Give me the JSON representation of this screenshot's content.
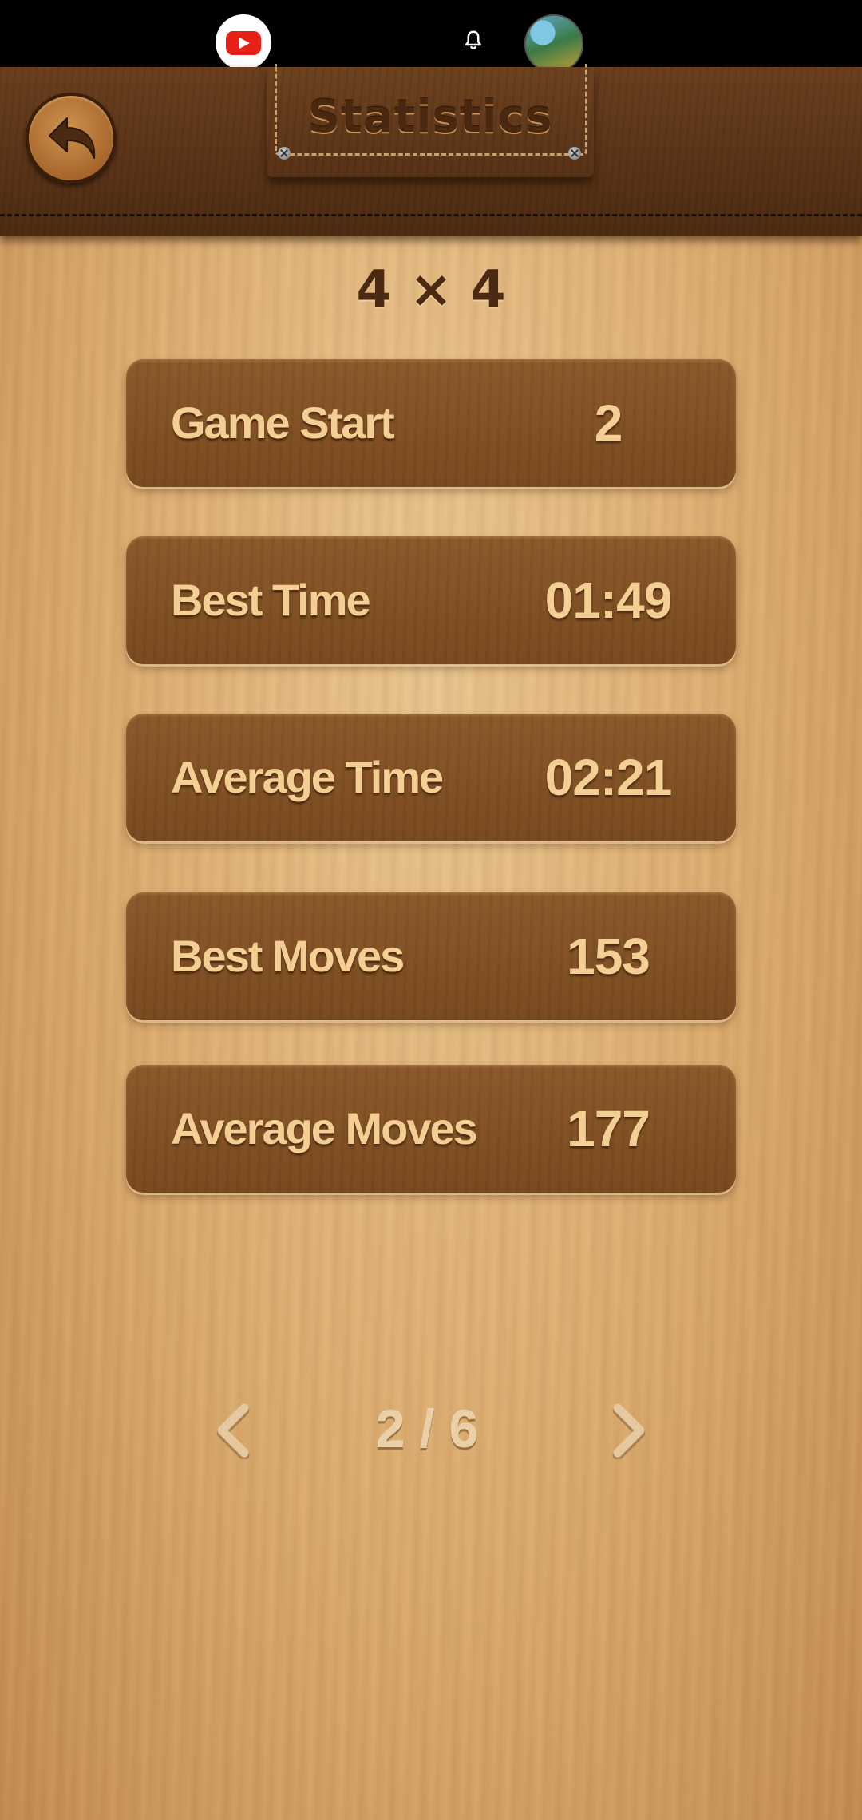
{
  "header": {
    "title": "Statistics"
  },
  "board": {
    "size_label": "4 × 4"
  },
  "stats": [
    {
      "label": "Game Start",
      "value": "2"
    },
    {
      "label": "Best Time",
      "value": "01:49"
    },
    {
      "label": "Average Time",
      "value": "02:21"
    },
    {
      "label": "Best Moves",
      "value": "153"
    },
    {
      "label": "Average Moves",
      "value": "177"
    }
  ],
  "pager": {
    "indicator": "2 / 6"
  },
  "icons": {
    "status_app": "youtube-icon",
    "status_notification": "bell-icon",
    "back": "undo-arrow-icon",
    "prev": "chevron-left-icon",
    "next": "chevron-right-icon"
  },
  "colors": {
    "header_leather": "#5a3318",
    "card_wood": "#835127",
    "card_text": "#f3cf94",
    "title_text": "#4a2810",
    "background_wood": "#dcac6e"
  }
}
